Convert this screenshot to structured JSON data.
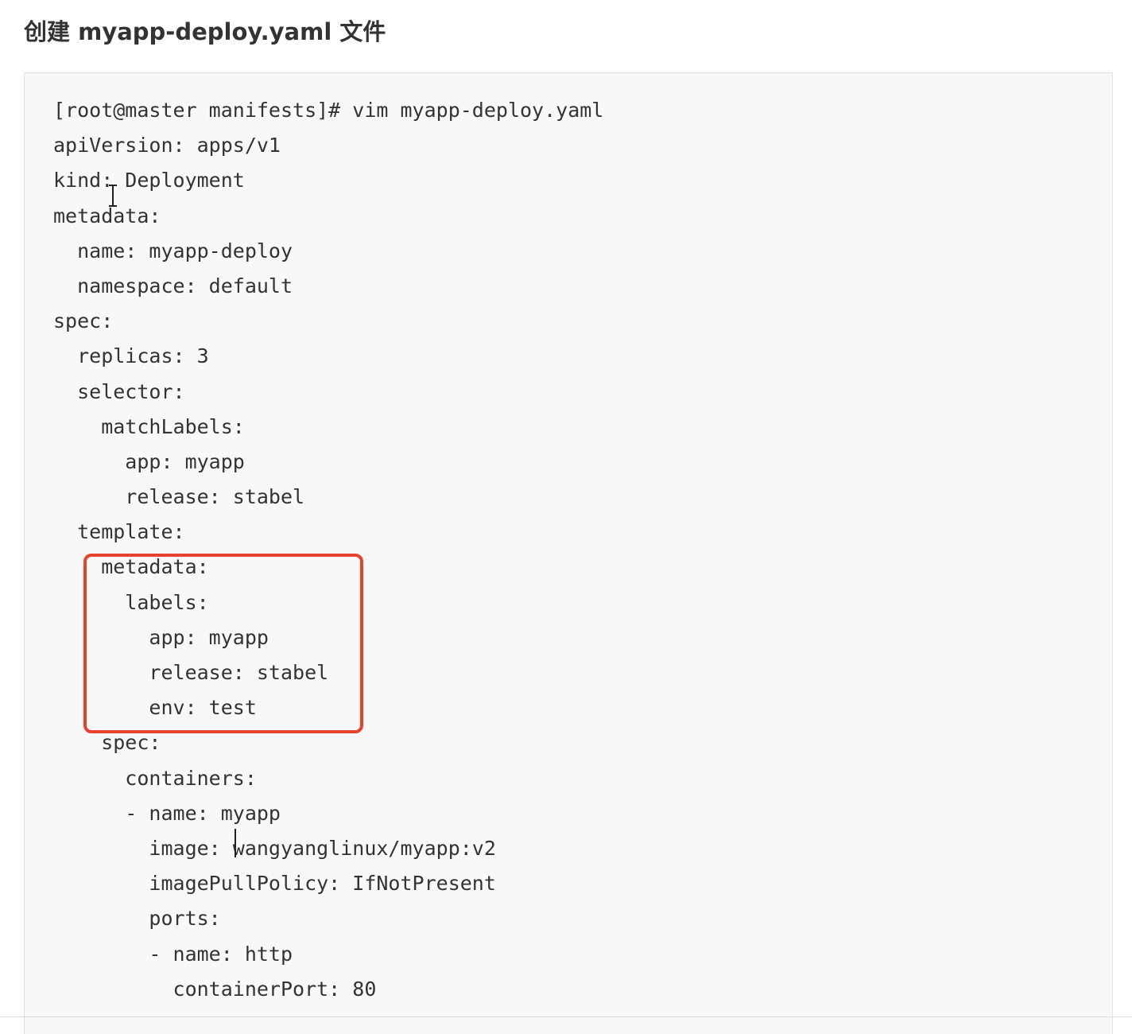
{
  "heading": "创建 myapp-deploy.yaml 文件",
  "code_block": {
    "lines": [
      "[root@master manifests]# vim myapp-deploy.yaml",
      "apiVersion: apps/v1",
      "kind: Deployment",
      "metadata:",
      "  name: myapp-deploy",
      "  namespace: default",
      "spec:",
      "  replicas: 3",
      "  selector:",
      "    matchLabels:",
      "      app: myapp",
      "      release: stabel",
      "  template:",
      "    metadata:",
      "      labels:",
      "        app: myapp",
      "        release: stabel",
      "        env: test",
      "    spec:",
      "      containers:",
      "      - name: myapp",
      "        image: wangyanglinux/myapp:v2",
      "        imagePullPolicy: IfNotPresent",
      "        ports:",
      "        - name: http",
      "          containerPort: 80"
    ]
  },
  "highlight": {
    "color": "#e8412e",
    "first_line": 13,
    "last_line": 17
  },
  "colors": {
    "code_background": "#f8f8f8",
    "code_text": "#333333",
    "heading_text": "#333333"
  }
}
